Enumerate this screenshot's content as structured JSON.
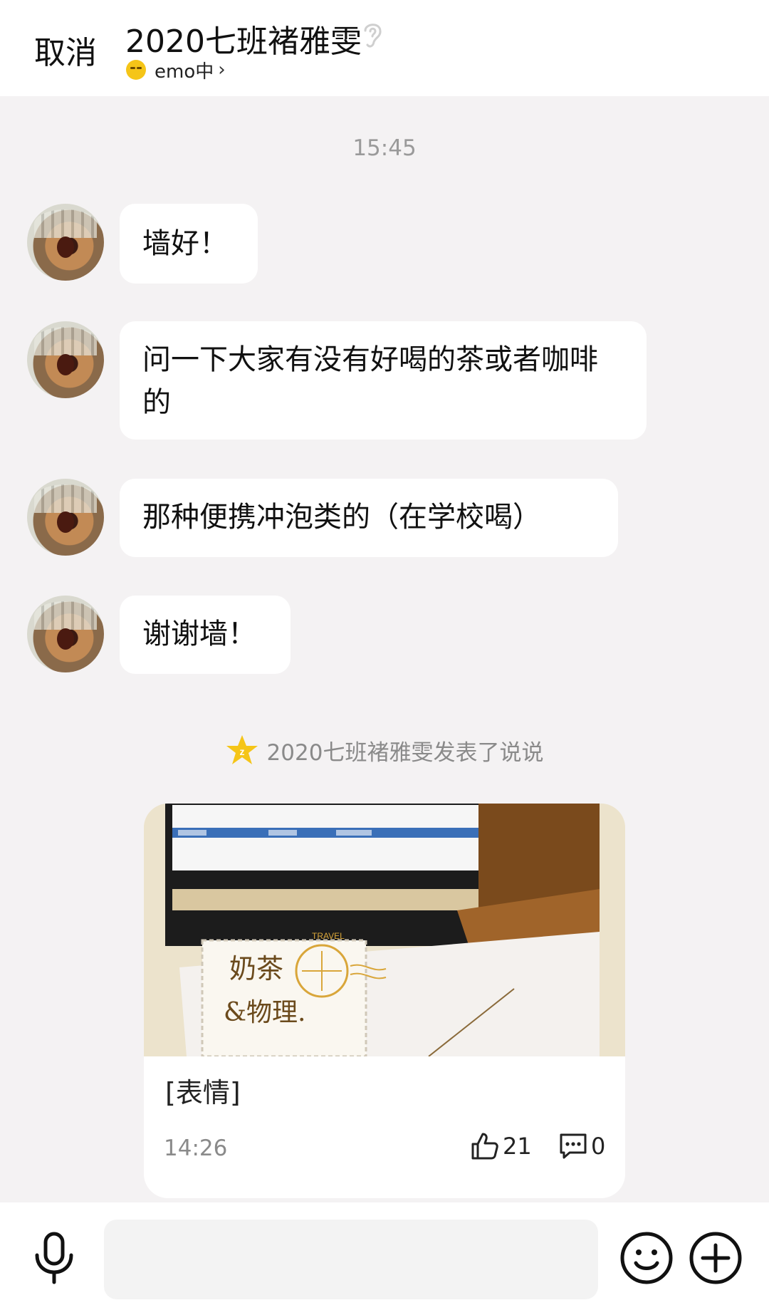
{
  "header": {
    "cancel_label": "取消",
    "title": "2020七班褚雅雯",
    "status_text": "emo中",
    "status_chevron": "›"
  },
  "timestamp": "15:45",
  "messages": [
    {
      "text": "墙好！"
    },
    {
      "text": "问一下大家有没有好喝的茶或者咖啡的"
    },
    {
      "text": "那种便携冲泡类的（在学校喝）"
    },
    {
      "text": "谢谢墙！"
    }
  ],
  "notification": {
    "text": "2020七班褚雅雯发表了说说",
    "icon": "qzone-star-icon"
  },
  "post": {
    "image_caption": [
      "奶茶",
      "&物理."
    ],
    "stamp_text": "TRAVEL",
    "text": "[表情]",
    "time": "14:26",
    "likes": "21",
    "comments": "0"
  },
  "input": {
    "placeholder": ""
  },
  "icons": {
    "header": "ear-icon",
    "mic": "microphone-icon",
    "emoji": "smiley-icon",
    "add": "plus-icon"
  },
  "colors": {
    "background": "#f4f2f3",
    "bubble": "#ffffff",
    "secondary_text": "#8a8a8a",
    "qzone_star": "#f5c518"
  }
}
